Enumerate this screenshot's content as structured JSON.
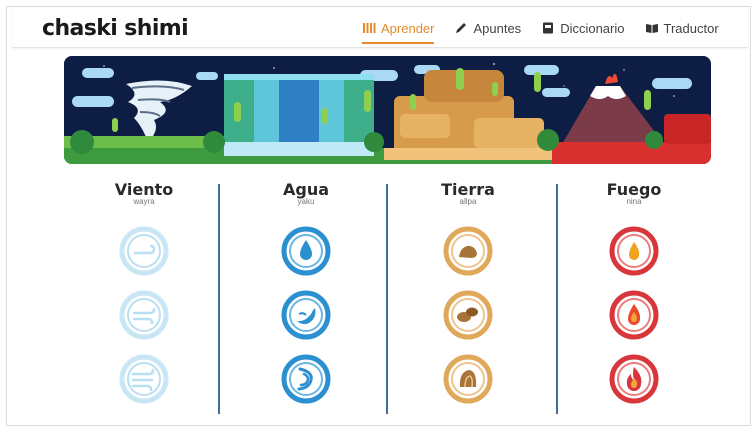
{
  "app": {
    "logo": "chaski shimi"
  },
  "nav": [
    {
      "label": "Aprender",
      "icon": "bars-icon",
      "active": true
    },
    {
      "label": "Apuntes",
      "icon": "pencil-icon",
      "active": false
    },
    {
      "label": "Diccionario",
      "icon": "book-icon",
      "active": false
    },
    {
      "label": "Traductor",
      "icon": "open-book-icon",
      "active": false
    }
  ],
  "elements": [
    {
      "title": "Viento",
      "subtitle": "wayra",
      "color": "#b9dff2",
      "icons": [
        "wind-level-1-icon",
        "wind-level-2-icon",
        "wind-level-3-icon"
      ]
    },
    {
      "title": "Agua",
      "subtitle": "yaku",
      "color": "#2b8fd0",
      "icons": [
        "water-drop-icon",
        "water-wave-icon",
        "water-swirl-icon"
      ]
    },
    {
      "title": "Tierra",
      "subtitle": "allpa",
      "color": "#e0a85a",
      "icons": [
        "rock-icon",
        "rocks-icon",
        "mountain-rock-icon"
      ]
    },
    {
      "title": "Fuego",
      "subtitle": "nina",
      "color": "#d9363b",
      "icons": [
        "flame-small-icon",
        "flame-medium-icon",
        "flame-large-icon"
      ]
    }
  ]
}
